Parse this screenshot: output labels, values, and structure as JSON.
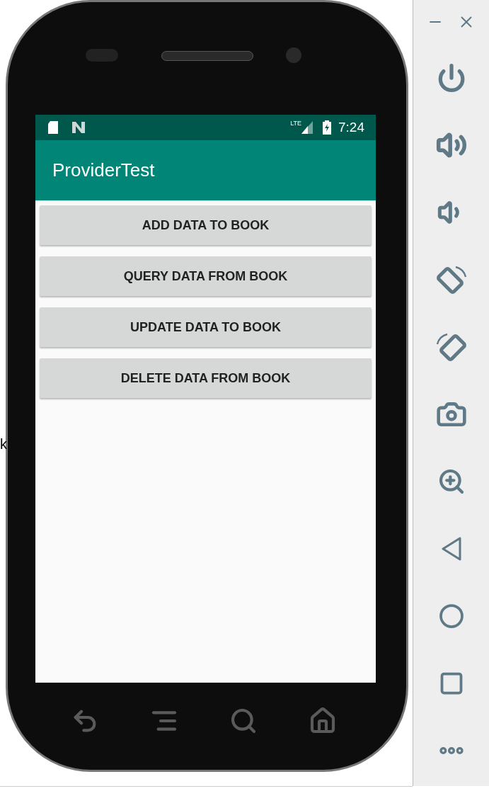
{
  "background_text": "k",
  "status_bar": {
    "network": "LTE",
    "time": "7:24"
  },
  "app_bar": {
    "title": "ProviderTest"
  },
  "buttons": [
    {
      "label": "ADD DATA TO BOOK"
    },
    {
      "label": "QUERY DATA FROM BOOK"
    },
    {
      "label": "UPDATE DATA TO BOOK"
    },
    {
      "label": "DELETE DATA FROM BOOK"
    }
  ]
}
